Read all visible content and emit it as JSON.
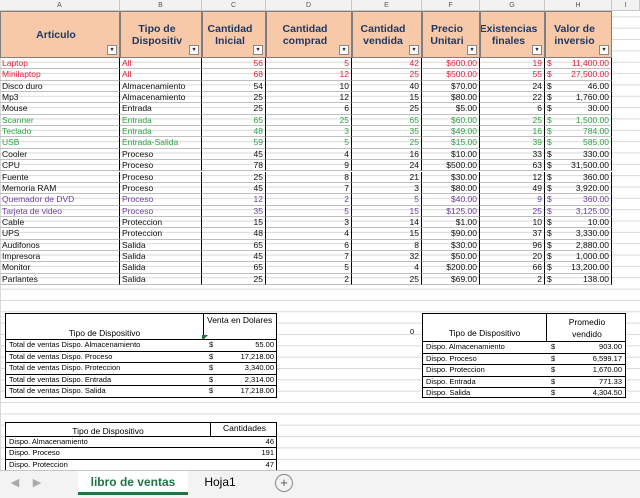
{
  "columns": [
    "A",
    "B",
    "C",
    "D",
    "E",
    "F",
    "G",
    "H",
    "I"
  ],
  "headers": [
    "Articulo",
    "Tipo de Dispositiv",
    "Cantidad Inicial",
    "Cantidad comprad",
    "Cantidad vendida",
    "Precio Unitari",
    "Existencias finales",
    "Valor de inversio"
  ],
  "rows": [
    {
      "c": "red",
      "v": [
        "Laptop",
        "All",
        "56",
        "5",
        "42",
        "$600.00",
        "19",
        "$",
        "11,400.00"
      ]
    },
    {
      "c": "red",
      "v": [
        "Minilaptop",
        "All",
        "68",
        "12",
        "25",
        "$500.00",
        "55",
        "$",
        "27,500.00"
      ]
    },
    {
      "c": "blk",
      "v": [
        "Disco duro",
        "Almacenamiento",
        "54",
        "10",
        "40",
        "$70.00",
        "24",
        "$",
        "46.00"
      ]
    },
    {
      "c": "blk",
      "v": [
        "Mp3",
        "Almacenamiento",
        "25",
        "12",
        "15",
        "$80.00",
        "22",
        "$",
        "1,760.00"
      ]
    },
    {
      "c": "blk",
      "v": [
        "Mouse",
        "Entrada",
        "25",
        "6",
        "25",
        "$5.00",
        "6",
        "$",
        "30.00"
      ]
    },
    {
      "c": "grn",
      "v": [
        "Scanner",
        "Entrada",
        "65",
        "25",
        "65",
        "$60.00",
        "25",
        "$",
        "1,500.00"
      ]
    },
    {
      "c": "grn",
      "v": [
        "Teclado",
        "Entrada",
        "48",
        "3",
        "35",
        "$49.00",
        "16",
        "$",
        "784.00"
      ]
    },
    {
      "c": "grn",
      "v": [
        "USB",
        "Entrada-Salida",
        "59",
        "5",
        "25",
        "$15.00",
        "39",
        "$",
        "585.00"
      ]
    },
    {
      "c": "blk",
      "v": [
        "Cooler",
        "Proceso",
        "45",
        "4",
        "16",
        "$10.00",
        "33",
        "$",
        "330.00"
      ]
    },
    {
      "c": "blk",
      "v": [
        "CPU",
        "Proceso",
        "78",
        "9",
        "24",
        "$500.00",
        "63",
        "$",
        "31,500.00"
      ]
    },
    {
      "c": "blk",
      "v": [
        "Fuente",
        "Proceso",
        "25",
        "8",
        "21",
        "$30.00",
        "12",
        "$",
        "360.00"
      ]
    },
    {
      "c": "blk",
      "v": [
        "Memoria RAM",
        "Proceso",
        "45",
        "7",
        "3",
        "$80.00",
        "49",
        "$",
        "3,920.00"
      ]
    },
    {
      "c": "pur",
      "v": [
        "Quemador de DVD",
        "Proceso",
        "12",
        "2",
        "5",
        "$40.00",
        "9",
        "$",
        "360.00"
      ]
    },
    {
      "c": "pur",
      "v": [
        "Tarjeta de video",
        "Proceso",
        "35",
        "5",
        "15",
        "$125.00",
        "25",
        "$",
        "3,125.00"
      ]
    },
    {
      "c": "blk",
      "v": [
        "Cable",
        "Proteccion",
        "15",
        "3",
        "14",
        "$1.00",
        "10",
        "$",
        "10.00"
      ]
    },
    {
      "c": "blk",
      "v": [
        "UPS",
        "Proteccion",
        "48",
        "4",
        "15",
        "$90.00",
        "37",
        "$",
        "3,330.00"
      ]
    },
    {
      "c": "blk",
      "v": [
        "Audifonos",
        "Salida",
        "65",
        "6",
        "8",
        "$30.00",
        "96",
        "$",
        "2,880.00"
      ]
    },
    {
      "c": "blk",
      "v": [
        "Impresora",
        "Salida",
        "45",
        "7",
        "32",
        "$50.00",
        "20",
        "$",
        "1,000.00"
      ]
    },
    {
      "c": "blk",
      "v": [
        "Monitor",
        "Salida",
        "65",
        "5",
        "4",
        "$200.00",
        "66",
        "$",
        "13,200.00"
      ]
    },
    {
      "c": "blk",
      "v": [
        "Parlantes",
        "Salida",
        "25",
        "2",
        "25",
        "$69.00",
        "2",
        "$",
        "138.00"
      ]
    }
  ],
  "ventas": {
    "h1": "Tipo de Dispositivo",
    "h2": "Venta en Dolares",
    "rows": [
      [
        "Total de ventas Dispo. Almacenamiento",
        "$",
        "55.00"
      ],
      [
        "Total de ventas Dispo. Proceso",
        "$",
        "17,218.00"
      ],
      [
        "Total de ventas Dispo. Proteccion",
        "$",
        "3,340.00"
      ],
      [
        "Total de ventas Dispo. Entrada",
        "$",
        "2,314.00"
      ],
      [
        "Total de ventas Dispo. Salida",
        "$",
        "17,218.00"
      ]
    ]
  },
  "zero": "0",
  "promedio": {
    "h1": "Tipo de Dispositivo",
    "h2": "Promedio vendido",
    "rows": [
      [
        "Dispo. Almacenamiento",
        "$",
        "903.00"
      ],
      [
        "Dispo. Proceso",
        "$",
        "6,599.17"
      ],
      [
        "Dispo. Proteccion",
        "$",
        "1,670.00"
      ],
      [
        "Dispo. Entrada",
        "$",
        "771.33"
      ],
      [
        "Dispo. Salida",
        "$",
        "4,304.50"
      ]
    ]
  },
  "cantidades": {
    "h1": "Tipo de Dispositivo",
    "h2": "Cantidades",
    "rows": [
      [
        "Dispo. Almacenamiento",
        "46"
      ],
      [
        "Dispo. Proceso",
        "191"
      ],
      [
        "Dispo. Proteccion",
        "47"
      ]
    ]
  },
  "tabs": {
    "active": "libro de ventas",
    "other": "Hoja1",
    "add": "+",
    "prev": "◀",
    "next": "▶"
  }
}
